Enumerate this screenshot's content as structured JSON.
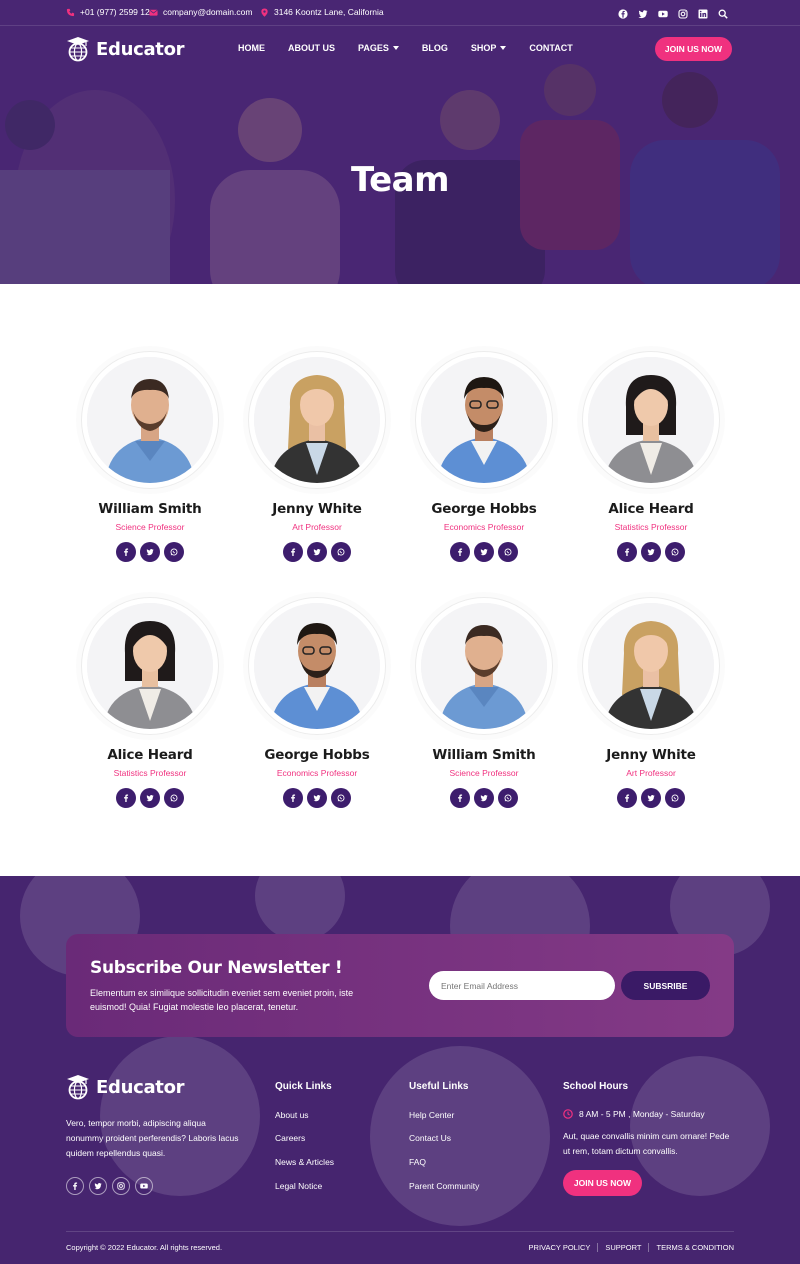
{
  "topbar": {
    "phone": "+01 (977) 2599 12",
    "email": "company@domain.com",
    "address": "3146 Koontz Lane, California",
    "social_icons": [
      "facebook-icon",
      "twitter-icon",
      "youtube-icon",
      "instagram-icon",
      "linkedin-icon",
      "search-icon"
    ]
  },
  "header": {
    "logo_text": "Educator",
    "nav": [
      {
        "label": "HOME",
        "dropdown": false
      },
      {
        "label": "ABOUT US",
        "dropdown": false
      },
      {
        "label": "PAGES",
        "dropdown": true
      },
      {
        "label": "BLOG",
        "dropdown": false
      },
      {
        "label": "SHOP",
        "dropdown": true
      },
      {
        "label": "CONTACT",
        "dropdown": false
      }
    ],
    "cta_label": "JOIN US NOW"
  },
  "hero": {
    "title": "Team"
  },
  "team": {
    "members": [
      {
        "name": "William Smith",
        "role": "Science Professor",
        "avatar": "man-beard-blue-shirt"
      },
      {
        "name": "Jenny White",
        "role": "Art Professor",
        "avatar": "woman-blonde-blazer"
      },
      {
        "name": "George Hobbs",
        "role": "Economics Professor",
        "avatar": "man-glasses-blue-shirt"
      },
      {
        "name": "Alice Heard",
        "role": "Statistics Professor",
        "avatar": "woman-dark-hair-grey-blazer"
      },
      {
        "name": "Alice Heard",
        "role": "Statistics Professor",
        "avatar": "woman-dark-hair-grey-blazer"
      },
      {
        "name": "George Hobbs",
        "role": "Economics Professor",
        "avatar": "man-glasses-blue-shirt"
      },
      {
        "name": "William Smith",
        "role": "Science Professor",
        "avatar": "man-beard-blue-shirt"
      },
      {
        "name": "Jenny White",
        "role": "Art Professor",
        "avatar": "woman-blonde-blazer"
      }
    ],
    "member_social_icons": [
      "facebook-icon",
      "twitter-icon",
      "whatsapp-icon"
    ]
  },
  "newsletter": {
    "title": "Subscribe Our Newsletter !",
    "description": "Elementum ex similique sollicitudin eveniet sem eveniet proin, iste euismod! Quia! Fugiat molestie leo placerat, tenetur.",
    "email_placeholder": "Enter Email Address",
    "button_label": "SUBSRIBE"
  },
  "footer": {
    "logo_text": "Educator",
    "about": "Vero, tempor morbi, adipiscing aliqua nonummy proident perferendis? Laboris lacus quidem repellendus quasi.",
    "social_icons": [
      "facebook-icon",
      "twitter-icon",
      "instagram-icon",
      "youtube-icon"
    ],
    "quick_links": {
      "title": "Quick Links",
      "items": [
        "About us",
        "Careers",
        "News & Articles",
        "Legal Notice"
      ]
    },
    "useful_links": {
      "title": "Useful Links",
      "items": [
        "Help Center",
        "Contact Us",
        "FAQ",
        "Parent Community"
      ]
    },
    "school_hours": {
      "title": "School Hours",
      "hours": "8 AM - 5 PM , Monday - Saturday",
      "description": "Aut, quae convallis minim cum ornare! Pede ut rem, totam dictum convallis.",
      "cta_label": "JOIN US NOW"
    },
    "copyright": "Copyright © 2022 Educator. All rights reserved.",
    "legal_links": [
      "PRIVACY POLICY",
      "SUPPORT",
      "TERMS & CONDITION"
    ]
  },
  "colors": {
    "primary_purple": "#46256f",
    "accent_pink": "#f0317f",
    "dark_purple": "#3d1d6d"
  }
}
